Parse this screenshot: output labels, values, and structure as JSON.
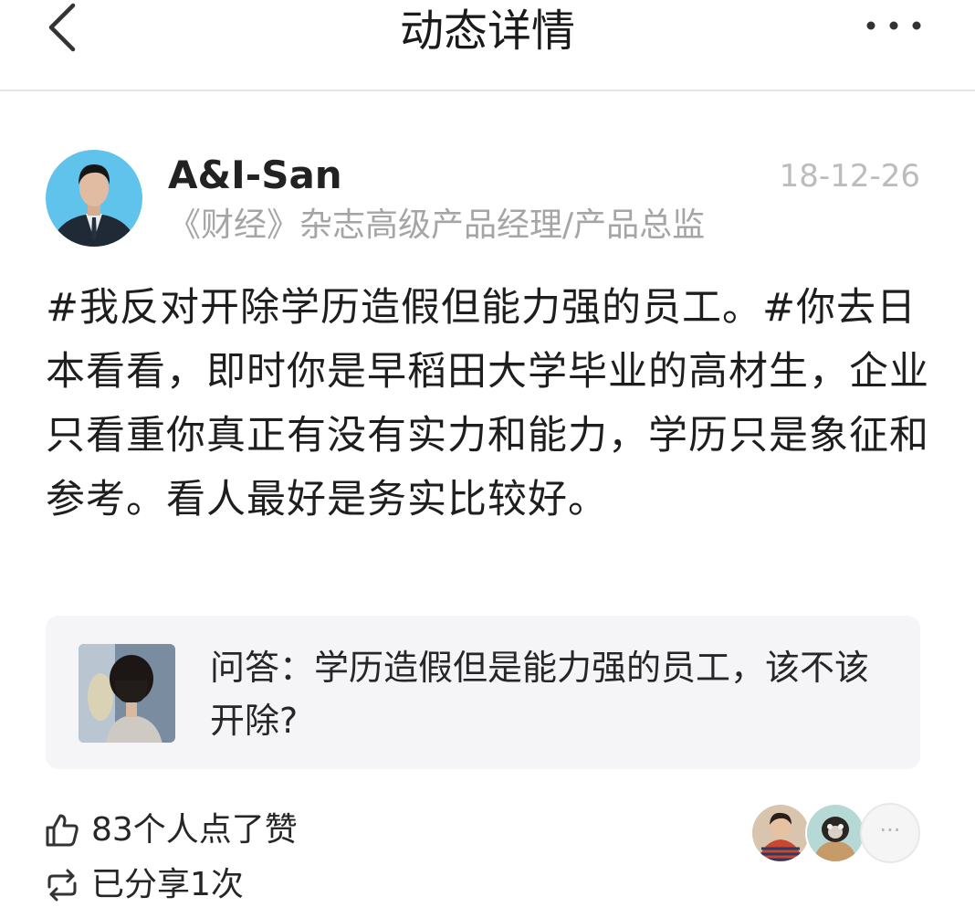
{
  "header": {
    "title": "动态详情",
    "back_icon": "chevron-left-icon",
    "more_icon": "more-dots-icon"
  },
  "post": {
    "author": "A&I-San",
    "date": "18-12-26",
    "author_title": "《财经》杂志高级产品经理/产品总监",
    "body": "#我反对开除学历造假但能力强的员工。#你去日本看看，即时你是早稻田大学毕业的高材生，企业只看重你真正有没有实力和能力，学历只是象征和参考。看人最好是务实比较好。"
  },
  "quote": {
    "text": "问答：学历造假但是能力强的员工，该不该开除?"
  },
  "stats": {
    "likes": "83个人点了赞",
    "shares": "已分享1次",
    "like_icon": "thumbs-up-icon",
    "share_icon": "repost-icon",
    "more_likers": "···"
  },
  "colors": {
    "avatar_bg": "#5fc3ec",
    "date": "#bcbcbc",
    "subtitle": "#a5a5a5",
    "card_bg": "#f5f5f7"
  }
}
